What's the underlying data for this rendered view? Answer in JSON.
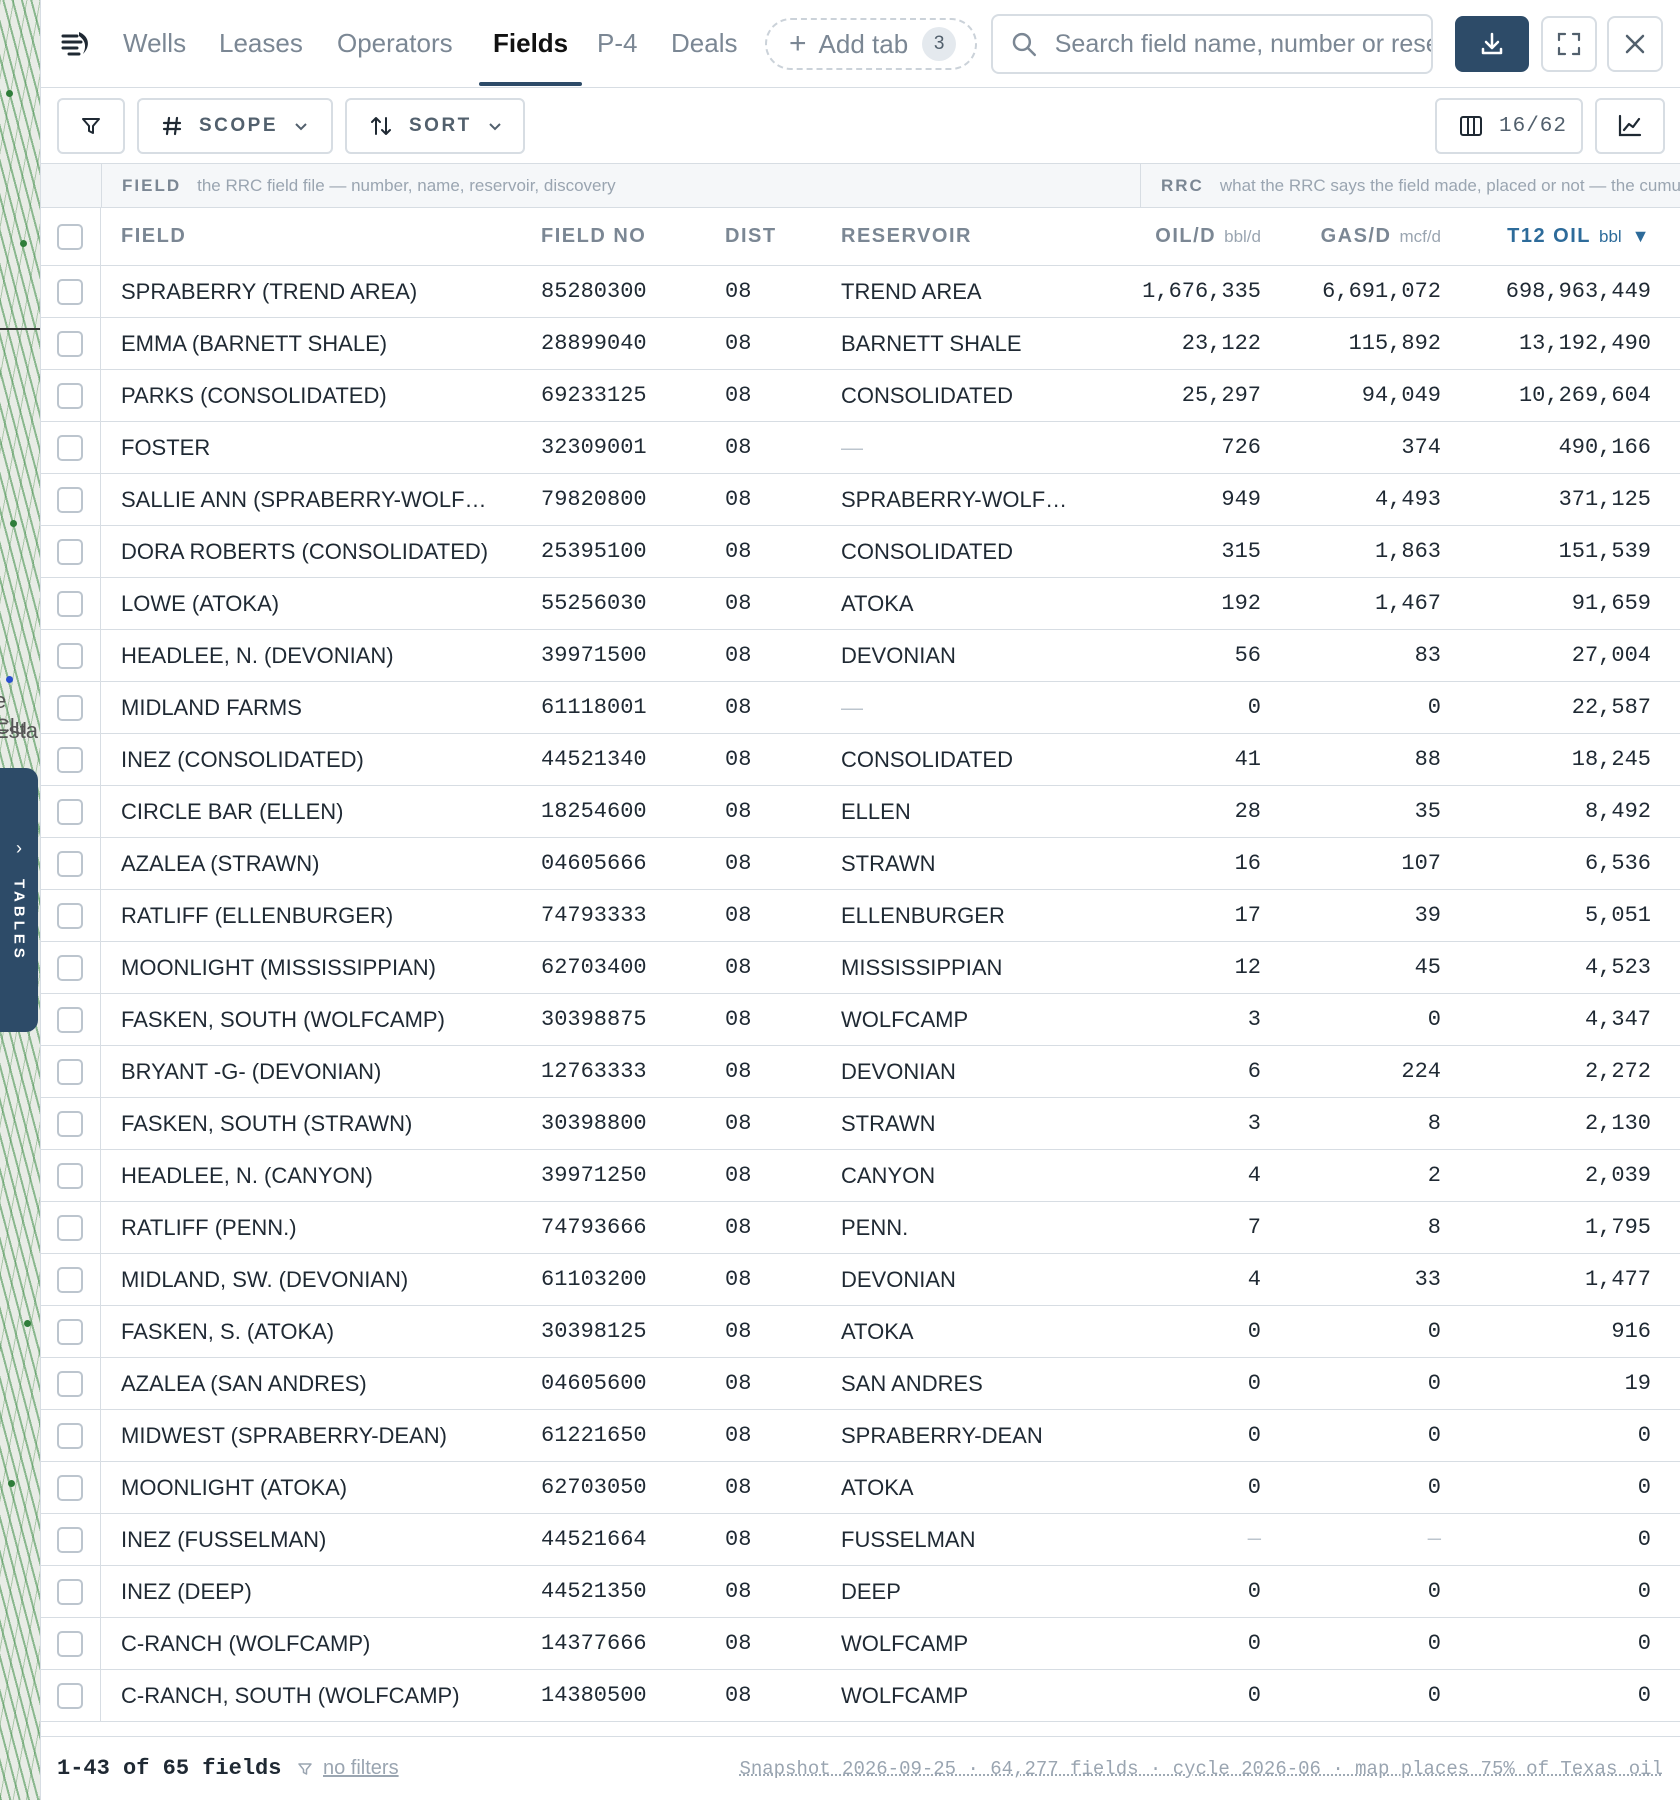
{
  "tabs": [
    {
      "label": "Wells",
      "active": false
    },
    {
      "label": "Leases",
      "active": false
    },
    {
      "label": "Operators",
      "active": false
    },
    {
      "label": "Fields",
      "active": true
    },
    {
      "label": "P-4",
      "active": false
    },
    {
      "label": "Deals",
      "active": false
    }
  ],
  "add_tab": {
    "label": "Add tab",
    "count": "3"
  },
  "search": {
    "placeholder": "Search field name, number or reservoir"
  },
  "toolbar": {
    "scope_label": "SCOPE",
    "sort_label": "SORT",
    "columns_count": "16/62"
  },
  "side_tab": {
    "label": "TABLES"
  },
  "map_labels": [
    "e Clu",
    "Esta"
  ],
  "groups": [
    {
      "name": "FIELD",
      "description": "the RRC field file — number, name, reservoir, discovery"
    },
    {
      "name": "RRC",
      "description": "what the RRC says the field made, placed or not — the cumulative"
    }
  ],
  "columns": [
    {
      "label": "FIELD",
      "unit": ""
    },
    {
      "label": "FIELD NO",
      "unit": ""
    },
    {
      "label": "DIST",
      "unit": ""
    },
    {
      "label": "RESERVOIR",
      "unit": ""
    },
    {
      "label": "OIL/D",
      "unit": "bbl/d"
    },
    {
      "label": "GAS/D",
      "unit": "mcf/d"
    },
    {
      "label": "T12 OIL",
      "unit": "bbl",
      "sort": "▼"
    }
  ],
  "rows": [
    {
      "field": "SPRABERRY (TREND AREA)",
      "field_no": "85280300",
      "dist": "08",
      "reservoir": "TREND AREA",
      "oil_d": "1,676,335",
      "gas_d": "6,691,072",
      "t12_oil": "698,963,449"
    },
    {
      "field": "EMMA (BARNETT SHALE)",
      "field_no": "28899040",
      "dist": "08",
      "reservoir": "BARNETT SHALE",
      "oil_d": "23,122",
      "gas_d": "115,892",
      "t12_oil": "13,192,490"
    },
    {
      "field": "PARKS (CONSOLIDATED)",
      "field_no": "69233125",
      "dist": "08",
      "reservoir": "CONSOLIDATED",
      "oil_d": "25,297",
      "gas_d": "94,049",
      "t12_oil": "10,269,604"
    },
    {
      "field": "FOSTER",
      "field_no": "32309001",
      "dist": "08",
      "reservoir": "—",
      "oil_d": "726",
      "gas_d": "374",
      "t12_oil": "490,166"
    },
    {
      "field": "SALLIE ANN (SPRABERRY-WOLF…",
      "field_no": "79820800",
      "dist": "08",
      "reservoir": "SPRABERRY-WOLF…",
      "oil_d": "949",
      "gas_d": "4,493",
      "t12_oil": "371,125"
    },
    {
      "field": "DORA ROBERTS (CONSOLIDATED)",
      "field_no": "25395100",
      "dist": "08",
      "reservoir": "CONSOLIDATED",
      "oil_d": "315",
      "gas_d": "1,863",
      "t12_oil": "151,539"
    },
    {
      "field": "LOWE (ATOKA)",
      "field_no": "55256030",
      "dist": "08",
      "reservoir": "ATOKA",
      "oil_d": "192",
      "gas_d": "1,467",
      "t12_oil": "91,659"
    },
    {
      "field": "HEADLEE, N. (DEVONIAN)",
      "field_no": "39971500",
      "dist": "08",
      "reservoir": "DEVONIAN",
      "oil_d": "56",
      "gas_d": "83",
      "t12_oil": "27,004"
    },
    {
      "field": "MIDLAND FARMS",
      "field_no": "61118001",
      "dist": "08",
      "reservoir": "—",
      "oil_d": "0",
      "gas_d": "0",
      "t12_oil": "22,587"
    },
    {
      "field": "INEZ (CONSOLIDATED)",
      "field_no": "44521340",
      "dist": "08",
      "reservoir": "CONSOLIDATED",
      "oil_d": "41",
      "gas_d": "88",
      "t12_oil": "18,245"
    },
    {
      "field": "CIRCLE BAR (ELLEN)",
      "field_no": "18254600",
      "dist": "08",
      "reservoir": "ELLEN",
      "oil_d": "28",
      "gas_d": "35",
      "t12_oil": "8,492"
    },
    {
      "field": "AZALEA (STRAWN)",
      "field_no": "04605666",
      "dist": "08",
      "reservoir": "STRAWN",
      "oil_d": "16",
      "gas_d": "107",
      "t12_oil": "6,536"
    },
    {
      "field": "RATLIFF (ELLENBURGER)",
      "field_no": "74793333",
      "dist": "08",
      "reservoir": "ELLENBURGER",
      "oil_d": "17",
      "gas_d": "39",
      "t12_oil": "5,051"
    },
    {
      "field": "MOONLIGHT (MISSISSIPPIAN)",
      "field_no": "62703400",
      "dist": "08",
      "reservoir": "MISSISSIPPIAN",
      "oil_d": "12",
      "gas_d": "45",
      "t12_oil": "4,523"
    },
    {
      "field": "FASKEN, SOUTH (WOLFCAMP)",
      "field_no": "30398875",
      "dist": "08",
      "reservoir": "WOLFCAMP",
      "oil_d": "3",
      "gas_d": "0",
      "t12_oil": "4,347"
    },
    {
      "field": "BRYANT -G- (DEVONIAN)",
      "field_no": "12763333",
      "dist": "08",
      "reservoir": "DEVONIAN",
      "oil_d": "6",
      "gas_d": "224",
      "t12_oil": "2,272"
    },
    {
      "field": "FASKEN, SOUTH (STRAWN)",
      "field_no": "30398800",
      "dist": "08",
      "reservoir": "STRAWN",
      "oil_d": "3",
      "gas_d": "8",
      "t12_oil": "2,130"
    },
    {
      "field": "HEADLEE, N. (CANYON)",
      "field_no": "39971250",
      "dist": "08",
      "reservoir": "CANYON",
      "oil_d": "4",
      "gas_d": "2",
      "t12_oil": "2,039"
    },
    {
      "field": "RATLIFF (PENN.)",
      "field_no": "74793666",
      "dist": "08",
      "reservoir": "PENN.",
      "oil_d": "7",
      "gas_d": "8",
      "t12_oil": "1,795"
    },
    {
      "field": "MIDLAND, SW. (DEVONIAN)",
      "field_no": "61103200",
      "dist": "08",
      "reservoir": "DEVONIAN",
      "oil_d": "4",
      "gas_d": "33",
      "t12_oil": "1,477"
    },
    {
      "field": "FASKEN, S. (ATOKA)",
      "field_no": "30398125",
      "dist": "08",
      "reservoir": "ATOKA",
      "oil_d": "0",
      "gas_d": "0",
      "t12_oil": "916"
    },
    {
      "field": "AZALEA (SAN ANDRES)",
      "field_no": "04605600",
      "dist": "08",
      "reservoir": "SAN ANDRES",
      "oil_d": "0",
      "gas_d": "0",
      "t12_oil": "19"
    },
    {
      "field": "MIDWEST (SPRABERRY-DEAN)",
      "field_no": "61221650",
      "dist": "08",
      "reservoir": "SPRABERRY-DEAN",
      "oil_d": "0",
      "gas_d": "0",
      "t12_oil": "0"
    },
    {
      "field": "MOONLIGHT (ATOKA)",
      "field_no": "62703050",
      "dist": "08",
      "reservoir": "ATOKA",
      "oil_d": "0",
      "gas_d": "0",
      "t12_oil": "0"
    },
    {
      "field": "INEZ (FUSSELMAN)",
      "field_no": "44521664",
      "dist": "08",
      "reservoir": "FUSSELMAN",
      "oil_d": "—",
      "gas_d": "—",
      "t12_oil": "0"
    },
    {
      "field": "INEZ (DEEP)",
      "field_no": "44521350",
      "dist": "08",
      "reservoir": "DEEP",
      "oil_d": "0",
      "gas_d": "0",
      "t12_oil": "0"
    },
    {
      "field": "C-RANCH (WOLFCAMP)",
      "field_no": "14377666",
      "dist": "08",
      "reservoir": "WOLFCAMP",
      "oil_d": "0",
      "gas_d": "0",
      "t12_oil": "0"
    },
    {
      "field": "C-RANCH, SOUTH (WOLFCAMP)",
      "field_no": "14380500",
      "dist": "08",
      "reservoir": "WOLFCAMP",
      "oil_d": "0",
      "gas_d": "0",
      "t12_oil": "0"
    }
  ],
  "footer": {
    "count": "1-43 of 65 fields",
    "filters": "no filters",
    "snapshot": "Snapshot 2026-09-25 · 64,277 fields · cycle 2026-06 · map places 75% of Texas oil"
  },
  "colors": {
    "accent": "#2d4b68",
    "sort": "#2d6b9a",
    "border": "#d7dde3",
    "muted": "#7b8794"
  }
}
